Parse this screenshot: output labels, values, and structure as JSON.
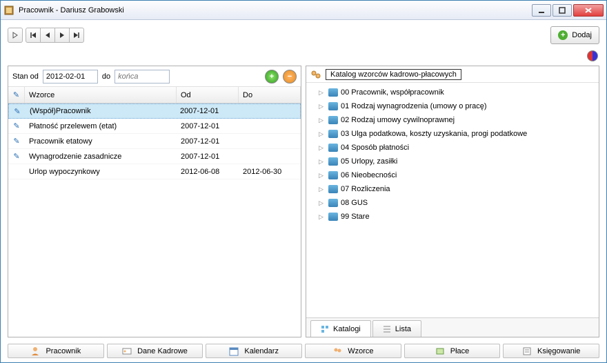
{
  "window": {
    "title": "Pracownik - Dariusz Grabowski"
  },
  "toolbar": {
    "add_label": "Dodaj"
  },
  "filter": {
    "stan_label": "Stan od",
    "date_value": "2012-02-01",
    "do_label": "do",
    "end_placeholder": "końca"
  },
  "columns": {
    "wzorce": "Wzorce",
    "od": "Od",
    "do": "Do"
  },
  "rows": [
    {
      "icon": true,
      "name": "(Współ)Pracownik",
      "od": "2007-12-01",
      "do": "",
      "selected": true
    },
    {
      "icon": true,
      "name": "Płatność przelewem (etat)",
      "od": "2007-12-01",
      "do": "",
      "selected": false
    },
    {
      "icon": true,
      "name": "Pracownik etatowy",
      "od": "2007-12-01",
      "do": "",
      "selected": false
    },
    {
      "icon": true,
      "name": "Wynagrodzenie zasadnicze",
      "od": "2007-12-01",
      "do": "",
      "selected": false
    },
    {
      "icon": false,
      "name": "Urlop wypoczynkowy",
      "od": "2012-06-08",
      "do": "2012-06-30",
      "selected": false
    }
  ],
  "tree": {
    "root": "Katalog wzorców kadrowo-płacowych",
    "items": [
      "00 Pracownik, współpracownik",
      "01 Rodzaj wynagrodzenia (umowy o pracę)",
      "02 Rodzaj umowy cywilnoprawnej",
      "03 Ulga podatkowa, koszty uzyskania, progi podatkowe",
      "04 Sposób płatności",
      "05 Urlopy, zasiłki",
      "06 Nieobecności",
      "07 Rozliczenia",
      "08 GUS",
      "99 Stare"
    ]
  },
  "right_tabs": {
    "katalogi": "Katalogi",
    "lista": "Lista"
  },
  "bottom_tabs": {
    "pracownik": "Pracownik",
    "dane": "Dane Kadrowe",
    "kalendarz": "Kalendarz",
    "wzorce": "Wzorce",
    "place": "Płace",
    "ksiegowanie": "Księgowanie"
  }
}
